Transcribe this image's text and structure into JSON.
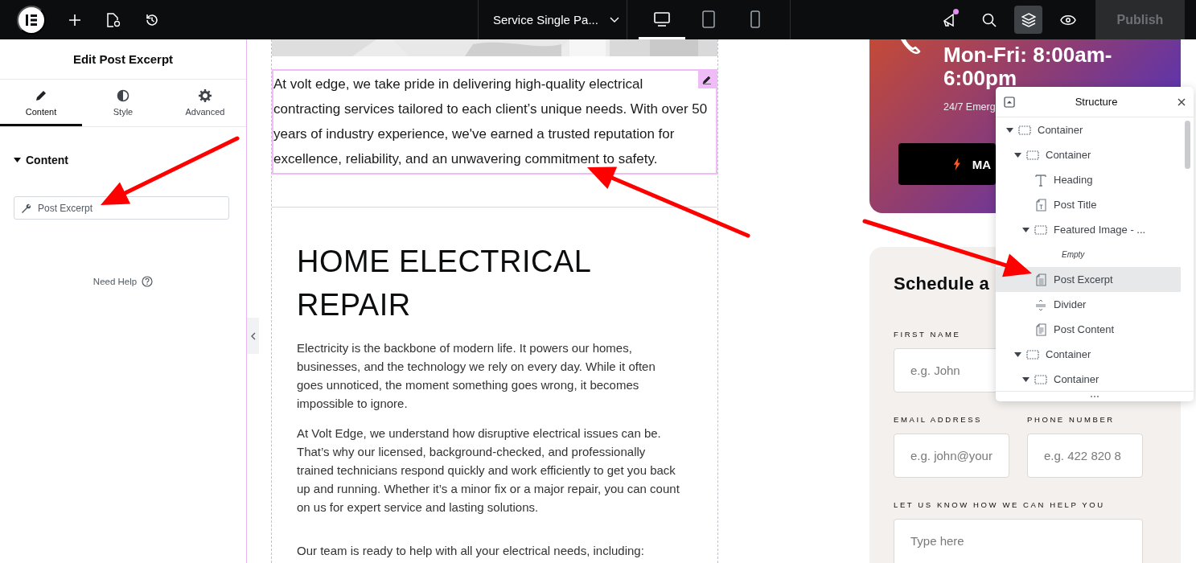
{
  "topbar": {
    "page_title": "Service Single Pa...",
    "has_notification": true,
    "structure_open": true,
    "devices": [
      {
        "kind": "desktop",
        "selected": true
      },
      {
        "kind": "tablet",
        "selected": false
      },
      {
        "kind": "mobile",
        "selected": false
      }
    ],
    "publish": {
      "label": "Publish",
      "disabled": true
    }
  },
  "panel": {
    "title": "Edit Post Excerpt",
    "tabs": [
      {
        "kind": "content",
        "label": "Content",
        "selected": true
      },
      {
        "kind": "style",
        "label": "Style",
        "selected": false
      },
      {
        "kind": "advanced",
        "label": "Advanced",
        "selected": false
      }
    ],
    "section": {
      "title": "Content",
      "expanded": true
    },
    "dynamic_tag": "Post Excerpt",
    "help": "Need Help"
  },
  "canvas": {
    "excerpt": "At volt edge, we take pride in delivering high-quality electrical contracting services tailored to each client’s unique needs. With over 50 years of industry experience, we've earned a trusted reputation for excellence, reliability, and an unwavering commitment to safety.",
    "heading": "HOME ELECTRICAL REPAIR",
    "paragraphs": [
      "Electricity is the backbone of modern life. It powers our homes, businesses, and the technology we rely on every day. While it often goes unnoticed, the moment something goes wrong, it becomes impossible to ignore.",
      "At Volt Edge, we understand how disruptive electrical issues can be. That’s why our licensed, background-checked, and professionally trained technicians respond quickly and work efficiently to get you back up and running. Whether it’s a minor fix or a major repair, you can count on us for expert service and lasting solutions.",
      "Our team is ready to help with all your electrical needs, including:"
    ],
    "hours": "Mon-Fri: 8:00am-6:00pm",
    "emergency": "24/7 Emerg",
    "cta": "MA",
    "form": {
      "title": "Schedule a",
      "fields": [
        {
          "label": "FIRST NAME",
          "placeholder": "e.g. John",
          "kind": "wide"
        },
        {
          "label": "EMAIL ADDRESS",
          "placeholder": "e.g. john@your",
          "kind": "half"
        },
        {
          "label": "PHONE NUMBER",
          "placeholder": "e.g. 422 820 8",
          "kind": "half"
        },
        {
          "label": "LET US KNOW HOW WE CAN HELP YOU",
          "placeholder": "Type here",
          "kind": "textarea"
        }
      ]
    }
  },
  "structure": {
    "title": "Structure",
    "tree": [
      {
        "label": "Container",
        "kind": "container",
        "expanded": true,
        "selected": false,
        "children": [
          {
            "label": "Container",
            "kind": "container",
            "expanded": true,
            "selected": false,
            "children": [
              {
                "label": "Heading",
                "kind": "heading",
                "selected": false
              },
              {
                "label": "Post Title",
                "kind": "post-title",
                "selected": false
              },
              {
                "label": "Featured Image - ...",
                "kind": "container",
                "expanded": true,
                "selected": false,
                "children": [
                  {
                    "label": "Empty",
                    "kind": "empty",
                    "selected": false
                  }
                ]
              },
              {
                "label": "Post Excerpt",
                "kind": "post-excerpt",
                "selected": true
              },
              {
                "label": "Divider",
                "kind": "divider",
                "selected": false
              },
              {
                "label": "Post Content",
                "kind": "post-content",
                "selected": false
              }
            ]
          },
          {
            "label": "Container",
            "kind": "container",
            "expanded": true,
            "selected": false,
            "children": [
              {
                "label": "Container",
                "kind": "container",
                "expanded": true,
                "selected": false
              }
            ]
          }
        ]
      }
    ]
  }
}
